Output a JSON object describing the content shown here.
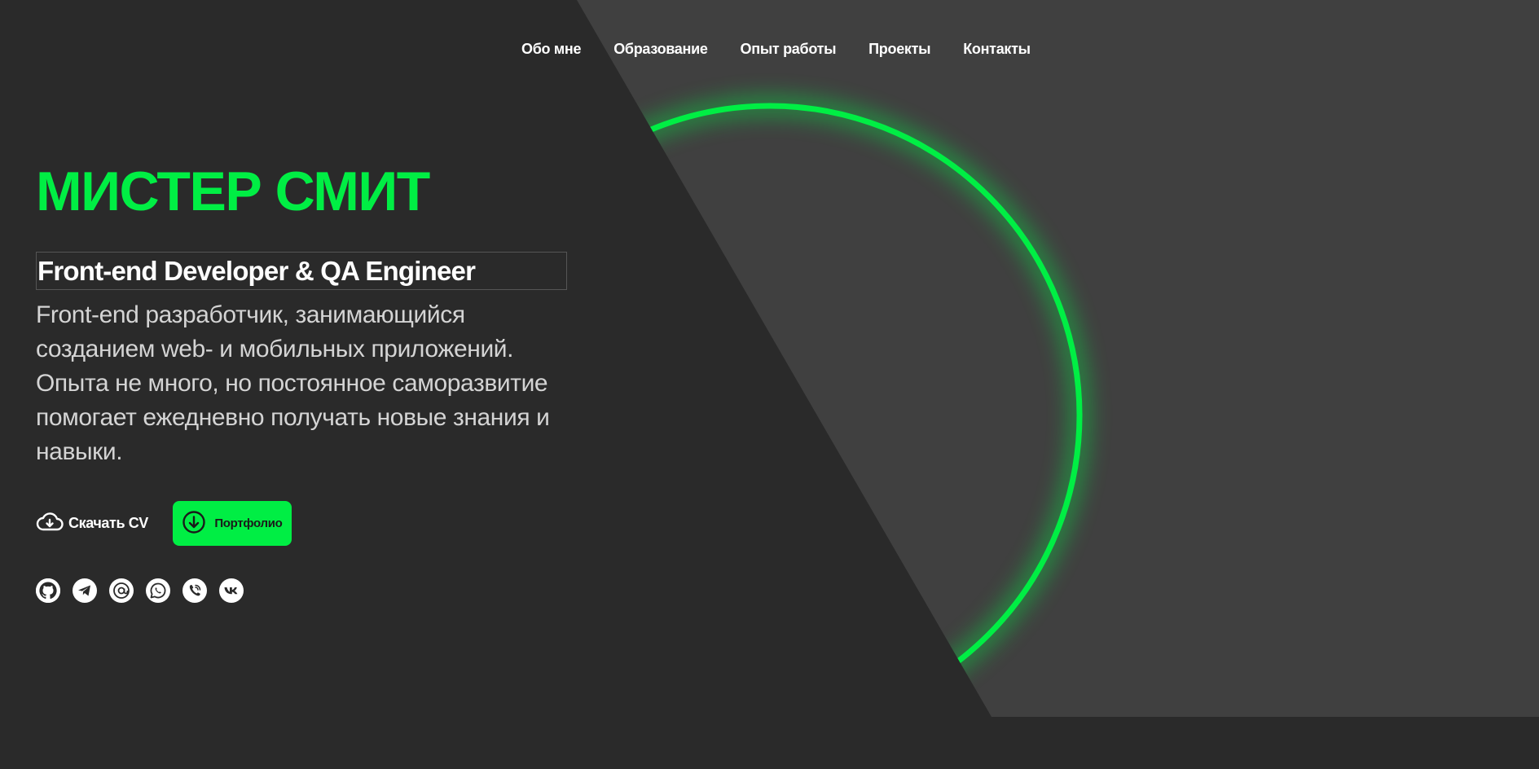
{
  "nav": {
    "items": [
      {
        "label": "Обо мне"
      },
      {
        "label": "Образование"
      },
      {
        "label": "Опыт работы"
      },
      {
        "label": "Проекты"
      },
      {
        "label": "Контакты"
      }
    ]
  },
  "hero": {
    "title": "МИСТЕР СМИТ",
    "subtitle": "Front-end Developer & QA Engineer",
    "description": "Front-end разработчик, занимающийся созданием web- и мобильных приложений. Опыта не много, но постоянное саморазвитие помогает ежедневно получать новые знания и навыки."
  },
  "actions": {
    "download_cv_label": "Скачать CV",
    "portfolio_label": "Портфолио"
  },
  "socials": [
    {
      "icon": "github-icon"
    },
    {
      "icon": "telegram-icon"
    },
    {
      "icon": "email-icon"
    },
    {
      "icon": "whatsapp-icon"
    },
    {
      "icon": "viber-icon"
    },
    {
      "icon": "vk-icon"
    }
  ],
  "colors": {
    "accent": "#00ee44",
    "background_dark": "#2a2a2a",
    "background_panel": "#404040",
    "text_primary": "#ffffff",
    "text_secondary": "#d4d4d4"
  }
}
